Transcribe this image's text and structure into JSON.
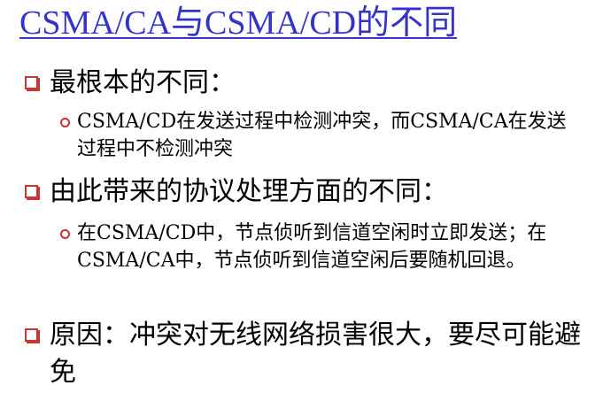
{
  "title": "CSMA/CA与CSMA/CD的不同",
  "colors": {
    "title": "#3333cc",
    "bullet": "#cc3333",
    "text": "#000000"
  },
  "icons": {
    "level1": "square-bullet-icon",
    "level2": "circle-bullet-icon"
  },
  "items": [
    {
      "text": "最根本的不同：",
      "sub": [
        {
          "text": "CSMA/CD在发送过程中检测冲突，而CSMA/CA在发送过程中不检测冲突"
        }
      ]
    },
    {
      "text": "由此带来的协议处理方面的不同：",
      "sub": [
        {
          "text": "在CSMA/CD中，节点侦听到信道空闲时立即发送；在CSMA/CA中，节点侦听到信道空闲后要随机回退。"
        }
      ]
    },
    {
      "text": "原因：冲突对无线网络损害很大，要尽可能避免",
      "sub": []
    }
  ]
}
